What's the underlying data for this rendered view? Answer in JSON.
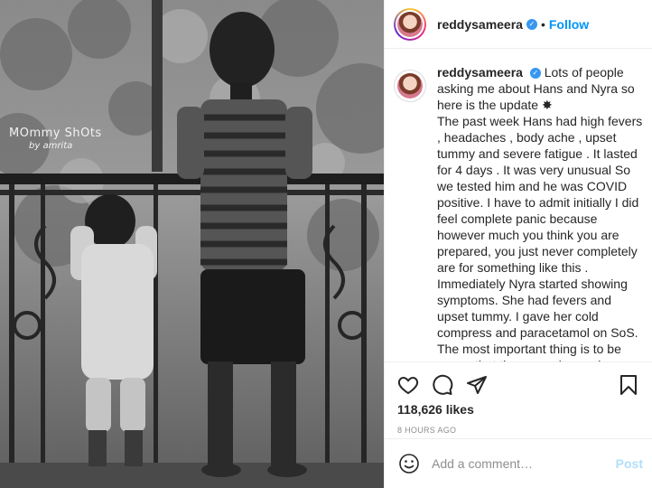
{
  "post": {
    "username": "reddysameera",
    "follow_label": "Follow",
    "separator": "•",
    "verified_icon": "verified-check-icon"
  },
  "photo": {
    "watermark_main": "MOmmy ShOts",
    "watermark_sub": "by amrita"
  },
  "caption": {
    "username": "reddysameera",
    "text": "Lots of people asking me about Hans and Nyra so here is the update ✸\nThe past week Hans had high fevers , headaches , body ache , upset tummy and severe fatigue . It lasted for 4 days . It was very unusual So we tested him and he was COVID positive. I have to admit initially I did feel complete panic because however much you think you are prepared, you just never completely are for something like this .\nImmediately Nyra started showing symptoms. She had fevers and upset tummy. I gave her cold compress and paracetamol on SoS.\nThe most important thing is to be aware that the second wave is affecting many children but doctors"
  },
  "stats": {
    "likes": "118,626 likes",
    "timestamp": "8 HOURS AGO"
  },
  "comment_box": {
    "placeholder": "Add a comment…",
    "post_label": "Post"
  }
}
